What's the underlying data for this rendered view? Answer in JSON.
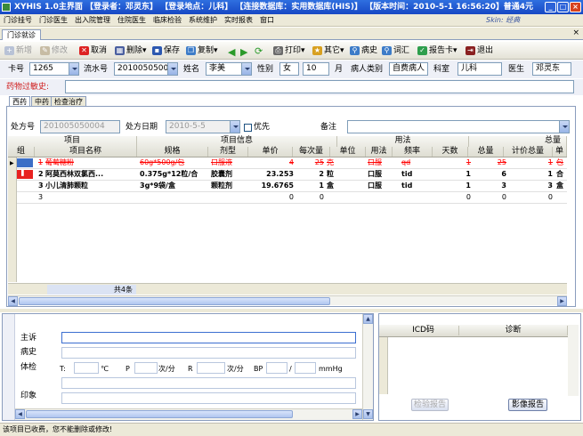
{
  "window": {
    "title": "XYHIS 1.0主界面",
    "login_user": "【登录者：邓灵东】",
    "login_place": "【登录地点：儿科】",
    "db": "【连接数据库：实用数据库(HIS)】",
    "version": "【版本时间：2010-5-1 16:56:20】",
    "edition": "普通4元"
  },
  "menu": [
    "门诊挂号",
    "门诊医生",
    "出入院管理",
    "住院医生",
    "临床检验",
    "系统维护",
    "实时报表",
    "窗口"
  ],
  "skin": "Skin: 经典",
  "tab": "门诊就诊",
  "toolbar": {
    "new": "新增",
    "edit": "修改",
    "cancel": "取消",
    "delete": "删除",
    "save": "保存",
    "copy": "复制",
    "print": "打印",
    "other": "其它",
    "history": "病史",
    "phrases": "词汇",
    "report_card": "报告卡",
    "exit": "退出"
  },
  "patient": {
    "card_label": "卡号",
    "card_value": "1265",
    "serial_label": "流水号",
    "serial_value": "201005050002",
    "name_label": "姓名",
    "name_value": "李美",
    "sex_label": "性别",
    "sex_value": "女",
    "age_value": "10",
    "age_unit": "月",
    "type_label": "病人类别",
    "type_value": "自费病人",
    "dept_label": "科室",
    "dept_value": "儿科",
    "doctor_label": "医生",
    "doctor_value": "邓灵东"
  },
  "allergy_label": "药物过敏史:",
  "subtabs": [
    "西药",
    "中药",
    "检查治疗"
  ],
  "rx": {
    "no_label": "处方号",
    "no_value": "201005050004",
    "date_label": "处方日期",
    "date_value": "2010-5-5",
    "priority_label": "优先",
    "note_label": "备注"
  },
  "grid": {
    "groups": [
      "项目",
      "项目信息",
      "用法",
      "总量"
    ],
    "columns": [
      "组",
      "项目名称",
      "规格",
      "剂型",
      "单价",
      "每次量",
      "单位",
      "用法",
      "频率",
      "天数",
      "总量",
      "计价总量",
      "单"
    ],
    "rows": [
      {
        "group": "1",
        "name": "葡萄糖粉",
        "spec": "60g*500g/包",
        "form": "口服液",
        "price": "4",
        "dose": "25",
        "unit": "克",
        "usage": "口服",
        "freq": "qd",
        "days": "1",
        "total": "25",
        "bill": "1",
        "u": "包",
        "style": "strike"
      },
      {
        "group": "2",
        "name": "阿莫西林双氯西...",
        "spec": "0.375g*12粒/合",
        "form": "胶囊剂",
        "price": "23.253",
        "dose": "2",
        "unit": "粒",
        "usage": "口服",
        "freq": "tid",
        "days": "1",
        "total": "6",
        "bill": "1",
        "u": "合",
        "style": "bold"
      },
      {
        "group": "3",
        "name": "小儿清肺颗粒",
        "spec": "3g*9袋/盒",
        "form": "颗粒剂",
        "price": "19.6765",
        "dose": "1",
        "unit": "盒",
        "usage": "口服",
        "freq": "tid",
        "days": "1",
        "total": "3",
        "bill": "3",
        "u": "盒",
        "style": "bold"
      },
      {
        "group": "3",
        "name": "",
        "spec": "",
        "form": "",
        "price": "0",
        "dose": "0",
        "unit": "",
        "usage": "",
        "freq": "",
        "days": "0",
        "total": "0",
        "bill": "0",
        "u": "",
        "style": "normal"
      }
    ],
    "footer": "共4条"
  },
  "clinical": {
    "complaint": "主诉",
    "history": "病史",
    "exam": "体检",
    "impression": "印象",
    "t": "T:",
    "t_unit": "℃",
    "p": "P",
    "p_unit": "次/分",
    "r": "R",
    "r_unit": "次/分",
    "bp": "BP",
    "bp_sep": "/",
    "bp_unit": "mmHg"
  },
  "diag": {
    "icd": "ICD码",
    "diag": "诊断",
    "check_btn": "检验报告",
    "image_btn": "影像报告"
  },
  "status": "该项目已收费，您不能删除或修改!"
}
